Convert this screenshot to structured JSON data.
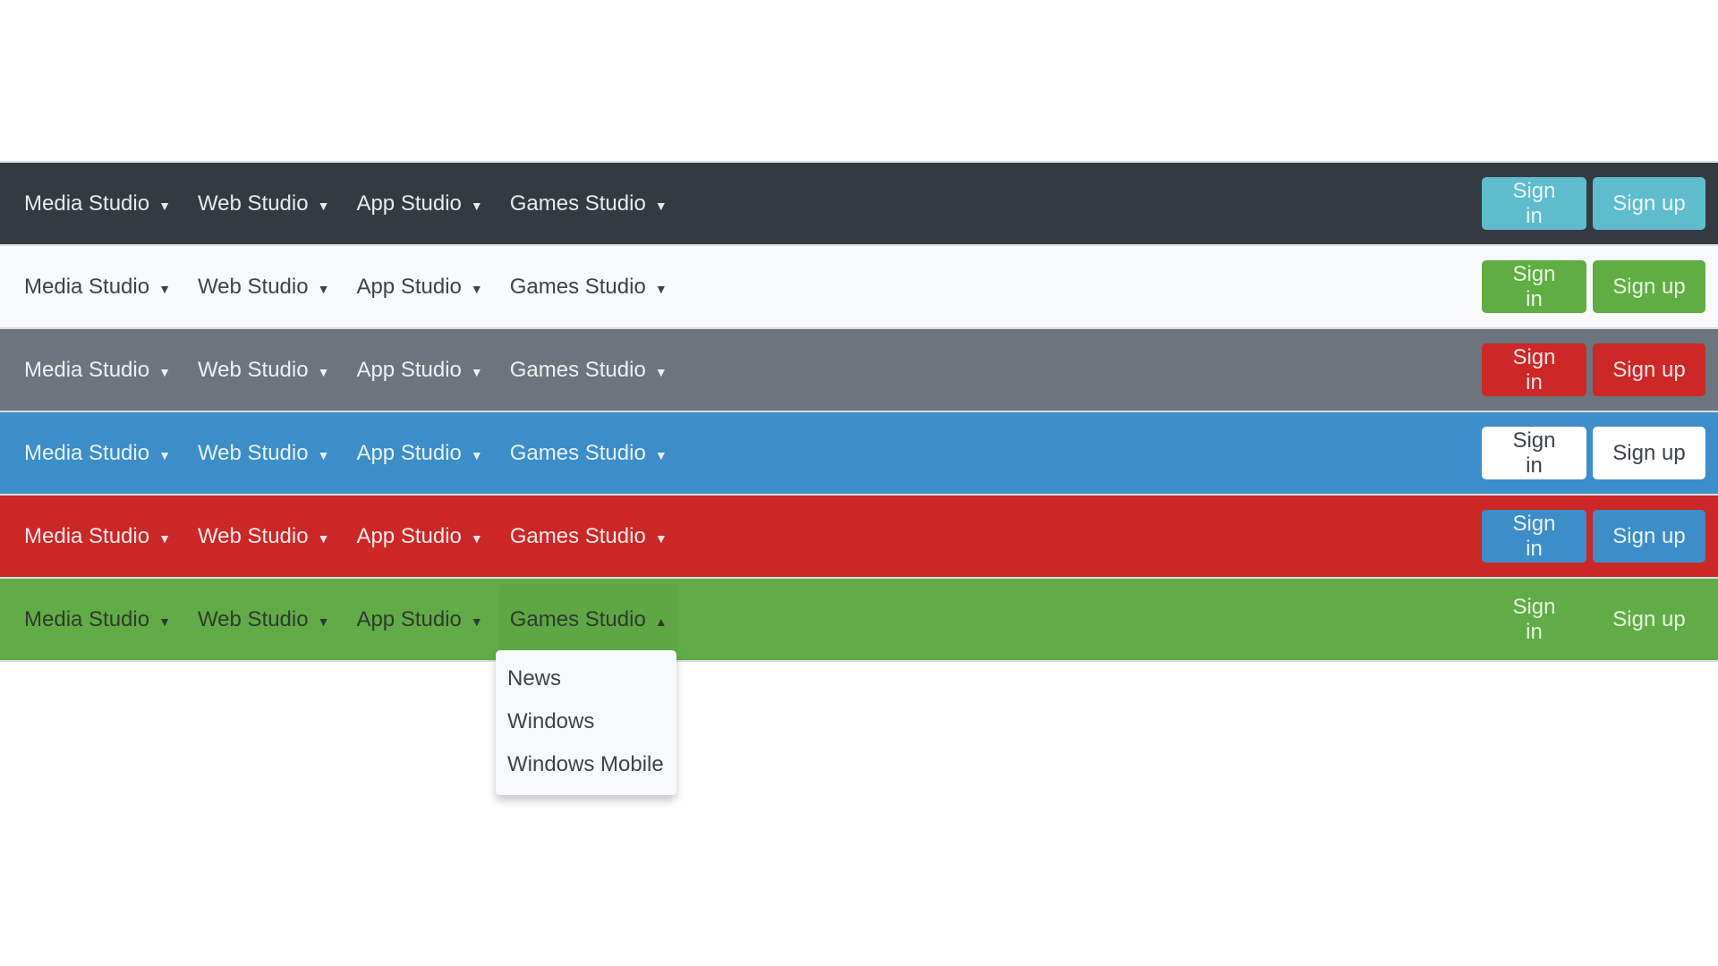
{
  "nav_labels": [
    "Media Studio",
    "Web Studio",
    "App Studio",
    "Games Studio"
  ],
  "caret_down": "▼",
  "caret_up": "▲",
  "navbars": [
    {
      "variant": "dark",
      "background": "#343a40",
      "items": [
        {
          "label": "Media Studio",
          "caret": "▼"
        },
        {
          "label": "Web Studio",
          "caret": "▼"
        },
        {
          "label": "App Studio",
          "caret": "▼"
        },
        {
          "label": "Games Studio",
          "caret": "▼"
        }
      ],
      "buttons": {
        "sign_in": "Sign in",
        "sign_up": "Sign up",
        "color": "#5ebccd"
      }
    },
    {
      "variant": "light",
      "background": "#f8f9fa",
      "items": [
        {
          "label": "Media Studio",
          "caret": "▼"
        },
        {
          "label": "Web Studio",
          "caret": "▼"
        },
        {
          "label": "App Studio",
          "caret": "▼"
        },
        {
          "label": "Games Studio",
          "caret": "▼"
        }
      ],
      "buttons": {
        "sign_in": "Sign in",
        "sign_up": "Sign up",
        "color": "#60ad44"
      }
    },
    {
      "variant": "gray",
      "background": "#6c757d",
      "items": [
        {
          "label": "Media Studio",
          "caret": "▼"
        },
        {
          "label": "Web Studio",
          "caret": "▼"
        },
        {
          "label": "App Studio",
          "caret": "▼"
        },
        {
          "label": "Games Studio",
          "caret": "▼"
        }
      ],
      "buttons": {
        "sign_in": "Sign in",
        "sign_up": "Sign up",
        "color": "#cc2828"
      }
    },
    {
      "variant": "blue",
      "background": "#3c8dc8",
      "items": [
        {
          "label": "Media Studio",
          "caret": "▼"
        },
        {
          "label": "Web Studio",
          "caret": "▼"
        },
        {
          "label": "App Studio",
          "caret": "▼"
        },
        {
          "label": "Games Studio",
          "caret": "▼"
        }
      ],
      "buttons": {
        "sign_in": "Sign in",
        "sign_up": "Sign up",
        "color": "#ffffff"
      }
    },
    {
      "variant": "red",
      "background": "#cb2727",
      "items": [
        {
          "label": "Media Studio",
          "caret": "▼"
        },
        {
          "label": "Web Studio",
          "caret": "▼"
        },
        {
          "label": "App Studio",
          "caret": "▼"
        },
        {
          "label": "Games Studio",
          "caret": "▼"
        }
      ],
      "buttons": {
        "sign_in": "Sign in",
        "sign_up": "Sign up",
        "color": "#3c8dc8"
      }
    },
    {
      "variant": "green",
      "background": "#62ac47",
      "items": [
        {
          "label": "Media Studio",
          "caret": "▼"
        },
        {
          "label": "Web Studio",
          "caret": "▼"
        },
        {
          "label": "App Studio",
          "caret": "▼"
        },
        {
          "label": "Games Studio",
          "caret": "▲",
          "expanded": true
        }
      ],
      "buttons": {
        "sign_in": "Sign in",
        "sign_up": "Sign up",
        "color": "#62ac47"
      }
    }
  ],
  "open_dropdown": {
    "parent": "Games Studio",
    "items": [
      "News",
      "Windows",
      "Windows Mobile"
    ]
  }
}
